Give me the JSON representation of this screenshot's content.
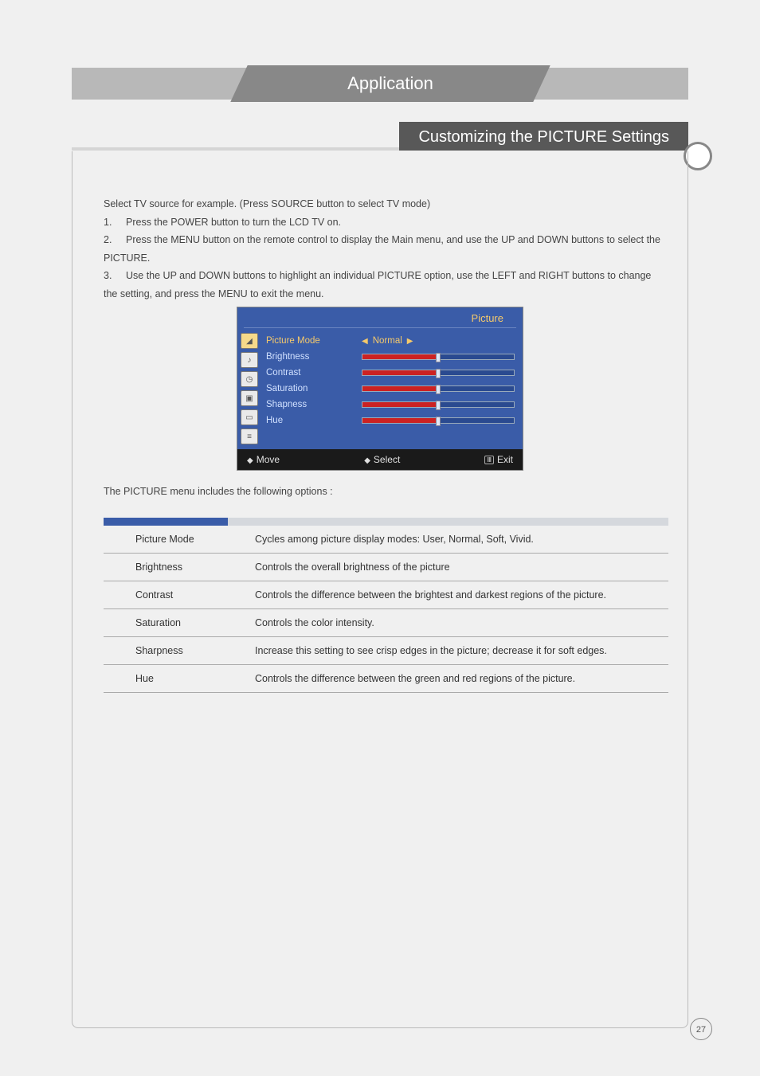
{
  "header": {
    "tab": "Application",
    "section": "Customizing the PICTURE Settings"
  },
  "intro": {
    "lead": "Select TV source for example. (Press SOURCE button to select TV mode)",
    "steps": [
      "Press the POWER button to turn the LCD TV on.",
      "Press the MENU button on the remote control to display the Main menu, and use the UP and DOWN buttons to select the PICTURE.",
      "Use the UP and DOWN buttons to highlight an individual PICTURE option, use the LEFT and RIGHT buttons to change the setting, and press the MENU to exit the menu."
    ]
  },
  "osd": {
    "title": "Picture",
    "rows": {
      "mode_label": "Picture Mode",
      "mode_value": "Normal",
      "brightness": "Brightness",
      "contrast": "Contrast",
      "saturation": "Saturation",
      "shapness": "Shapness",
      "hue": "Hue"
    },
    "footer": {
      "move": "Move",
      "select": "Select",
      "exit": "Exit"
    }
  },
  "options": {
    "intro": "The PICTURE menu includes the following options :",
    "rows": [
      {
        "name": "Picture Mode",
        "desc": "Cycles among picture display modes: User, Normal, Soft, Vivid."
      },
      {
        "name": "Brightness",
        "desc": "Controls the overall brightness of the picture"
      },
      {
        "name": "Contrast",
        "desc": "Controls the difference between the brightest and darkest regions of the picture."
      },
      {
        "name": "Saturation",
        "desc": "Controls the color intensity."
      },
      {
        "name": "Sharpness",
        "desc": "Increase this setting to see crisp edges in the picture; decrease it for soft edges."
      },
      {
        "name": "Hue",
        "desc": "Controls the difference between the green and red regions of the picture."
      }
    ]
  },
  "page_number": "27"
}
